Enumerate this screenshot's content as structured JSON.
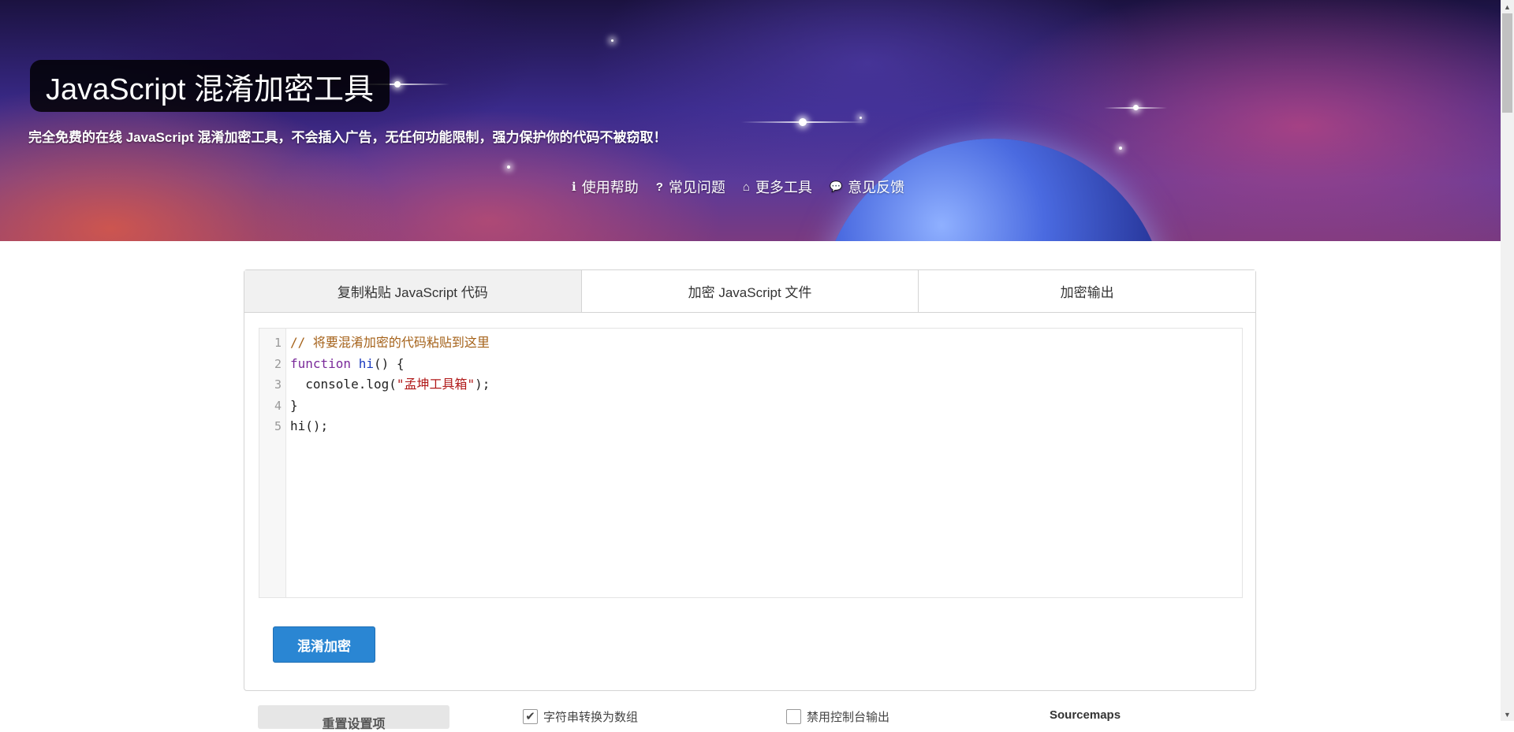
{
  "header": {
    "title": "JavaScript 混淆加密工具",
    "subtitle": "完全免费的在线 JavaScript 混淆加密工具，不会插入广告，无任何功能限制，强力保护你的代码不被窃取！",
    "nav": [
      {
        "icon": "info-icon",
        "glyph": "ℹ",
        "label": "使用帮助"
      },
      {
        "icon": "question-icon",
        "glyph": "?",
        "label": "常见问题"
      },
      {
        "icon": "home-icon",
        "glyph": "⌂",
        "label": "更多工具"
      },
      {
        "icon": "comments-icon",
        "glyph": "💬",
        "label": "意见反馈"
      }
    ]
  },
  "tabs": [
    {
      "label": "复制粘贴 JavaScript 代码",
      "active": true
    },
    {
      "label": "加密 JavaScript 文件",
      "active": false
    },
    {
      "label": "加密输出",
      "active": false
    }
  ],
  "editor": {
    "line_numbers": [
      "1",
      "2",
      "3",
      "4",
      "5"
    ],
    "lines": [
      [
        {
          "t": "comment",
          "v": "// 将要混淆加密的代码粘贴到这里"
        }
      ],
      [
        {
          "t": "keyword",
          "v": "function"
        },
        {
          "t": "plain",
          "v": " "
        },
        {
          "t": "def",
          "v": "hi"
        },
        {
          "t": "plain",
          "v": "() {"
        }
      ],
      [
        {
          "t": "plain",
          "v": "  console.log("
        },
        {
          "t": "string",
          "v": "\"孟坤工具箱\""
        },
        {
          "t": "plain",
          "v": ");"
        }
      ],
      [
        {
          "t": "plain",
          "v": "}"
        }
      ],
      [
        {
          "t": "plain",
          "v": "hi();"
        }
      ]
    ]
  },
  "actions": {
    "obfuscate_label": "混淆加密",
    "reset_label": "重置设置项"
  },
  "options": {
    "string_array": {
      "label": "字符串转换为数组",
      "checked": true
    },
    "disable_console": {
      "label": "禁用控制台输出",
      "checked": false
    },
    "sourcemaps_label": "Sourcemaps"
  },
  "colors": {
    "primary_button": "#2a86d3",
    "comment": "#a5621a",
    "keyword": "#7a2a9a",
    "string": "#b01818"
  }
}
